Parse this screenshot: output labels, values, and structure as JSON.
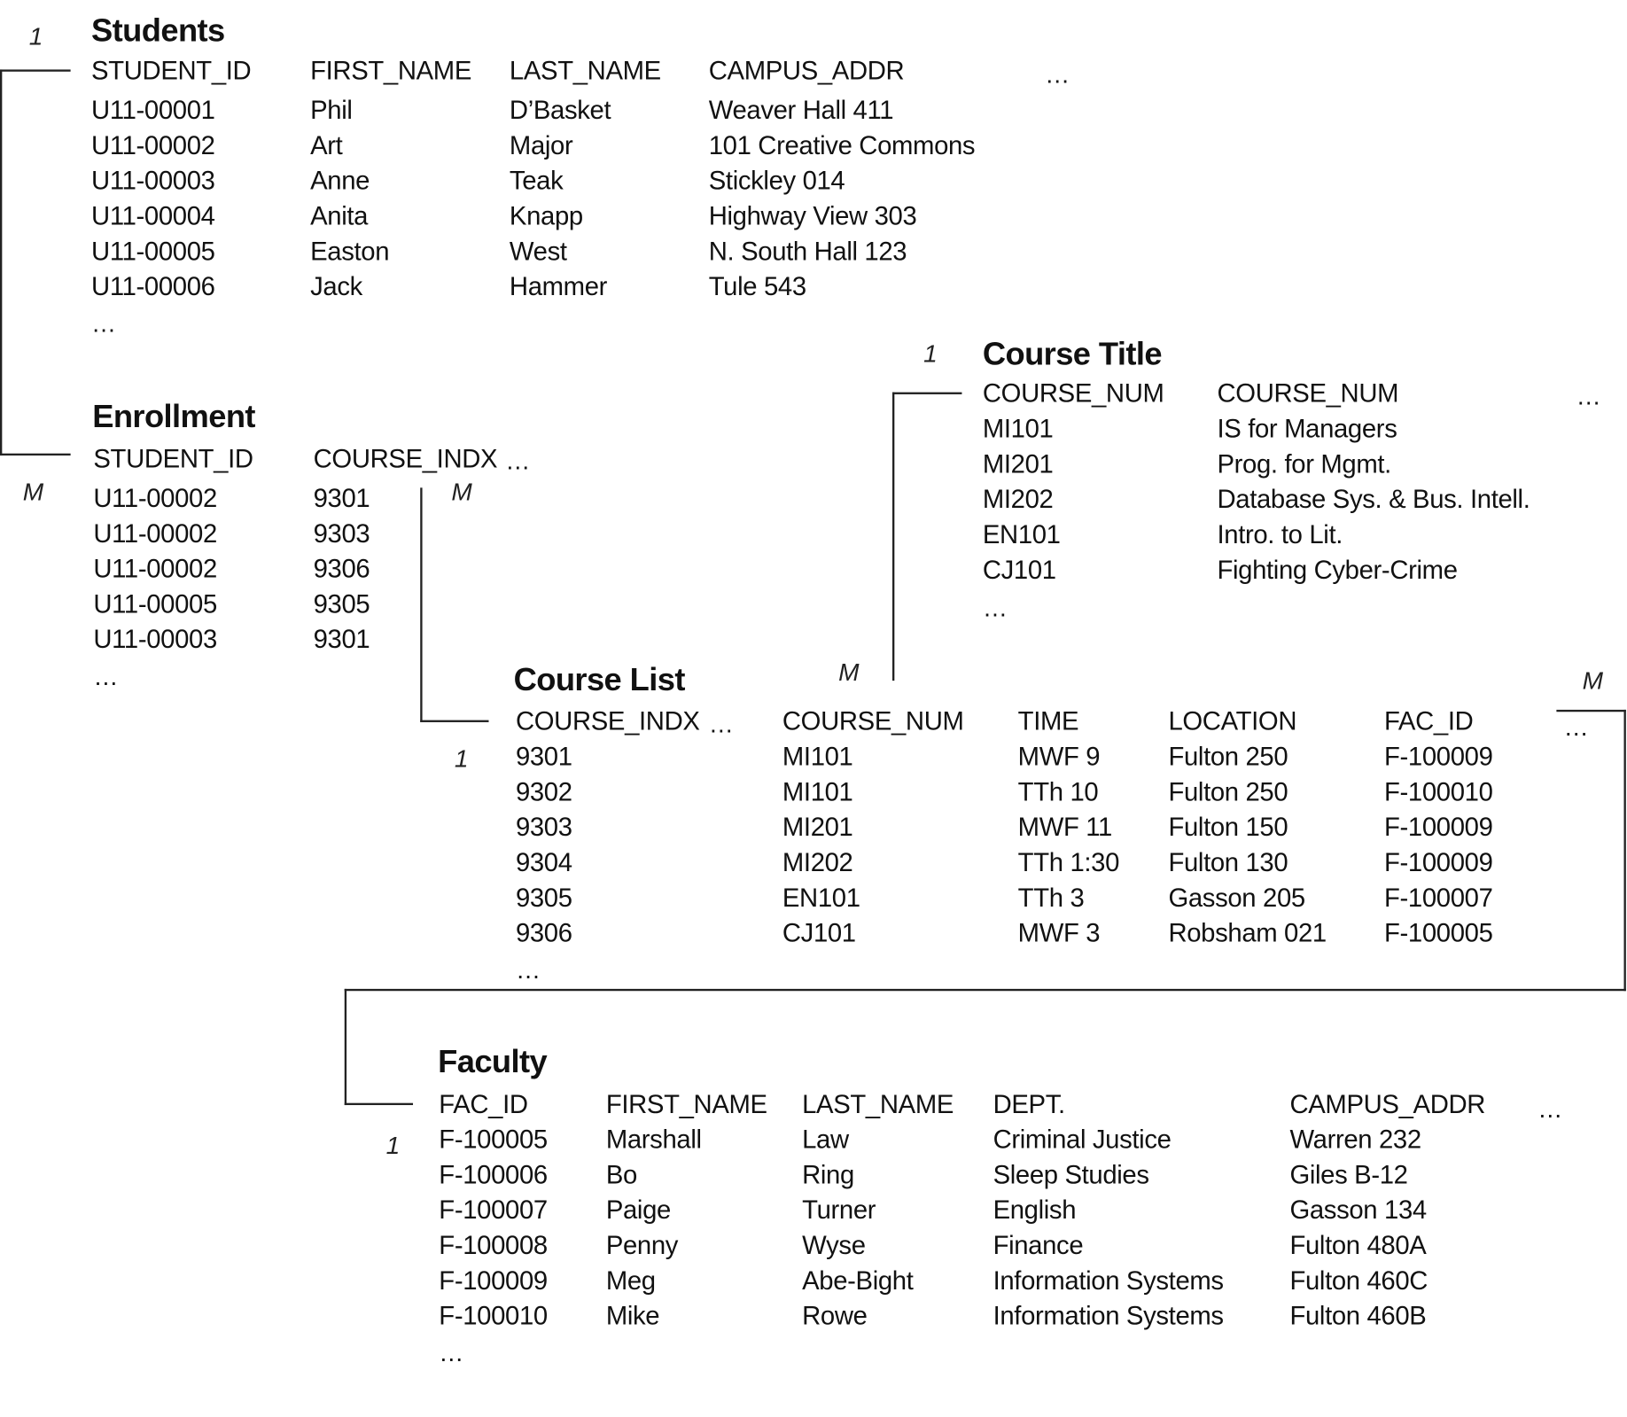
{
  "tables": {
    "students": {
      "title": "Students",
      "columns": [
        "STUDENT_ID",
        "FIRST_NAME",
        "LAST_NAME",
        "CAMPUS_ADDR"
      ],
      "more_columns": "…",
      "rows": [
        [
          "U11-00001",
          "Phil",
          "D’Basket",
          "Weaver Hall 411"
        ],
        [
          "U11-00002",
          "Art",
          "Major",
          "101 Creative Commons"
        ],
        [
          "U11-00003",
          "Anne",
          "Teak",
          "Stickley 014"
        ],
        [
          "U11-00004",
          "Anita",
          "Knapp",
          "Highway View 303"
        ],
        [
          "U11-00005",
          "Easton",
          "West",
          "N. South Hall 123"
        ],
        [
          "U11-00006",
          "Jack",
          "Hammer",
          "Tule 543"
        ]
      ],
      "more_rows": "…"
    },
    "enrollment": {
      "title": "Enrollment",
      "columns": [
        "STUDENT_ID",
        "COURSE_INDX"
      ],
      "more_columns": "…",
      "rows": [
        [
          "U11-00002",
          "9301"
        ],
        [
          "U11-00002",
          "9303"
        ],
        [
          "U11-00002",
          "9306"
        ],
        [
          "U11-00005",
          "9305"
        ],
        [
          "U11-00003",
          "9301"
        ]
      ],
      "more_rows": "…"
    },
    "course_title": {
      "title": "Course Title",
      "columns": [
        "COURSE_NUM",
        "COURSE_NUM"
      ],
      "more_columns": "…",
      "rows": [
        [
          "MI101",
          "IS for Managers"
        ],
        [
          "MI201",
          "Prog. for Mgmt."
        ],
        [
          "MI202",
          "Database Sys. & Bus. Intell."
        ],
        [
          "EN101",
          "Intro. to Lit."
        ],
        [
          "CJ101",
          "Fighting Cyber-Crime"
        ]
      ],
      "more_rows": "…"
    },
    "course_list": {
      "title": "Course List",
      "columns": [
        "COURSE_INDX",
        "COURSE_NUM",
        "TIME",
        "LOCATION",
        "FAC_ID"
      ],
      "inner_more_columns": "…",
      "more_columns": "…",
      "rows": [
        [
          "9301",
          "MI101",
          "MWF 9",
          "Fulton 250",
          "F-100009"
        ],
        [
          "9302",
          "MI101",
          "TTh 10",
          "Fulton 250",
          "F-100010"
        ],
        [
          "9303",
          "MI201",
          "MWF 11",
          "Fulton 150",
          "F-100009"
        ],
        [
          "9304",
          "MI202",
          "TTh 1:30",
          "Fulton 130",
          "F-100009"
        ],
        [
          "9305",
          "EN101",
          "TTh 3",
          "Gasson 205",
          "F-100007"
        ],
        [
          "9306",
          "CJ101",
          "MWF 3",
          "Robsham 021",
          "F-100005"
        ]
      ],
      "more_rows": "…"
    },
    "faculty": {
      "title": "Faculty",
      "columns": [
        "FAC_ID",
        "FIRST_NAME",
        "LAST_NAME",
        "DEPT.",
        "CAMPUS_ADDR"
      ],
      "more_columns": "…",
      "rows": [
        [
          "F-100005",
          "Marshall",
          "Law",
          "Criminal Justice",
          "Warren 232"
        ],
        [
          "F-100006",
          "Bo",
          "Ring",
          "Sleep Studies",
          "Giles B-12"
        ],
        [
          "F-100007",
          "Paige",
          "Turner",
          "English",
          "Gasson 134"
        ],
        [
          "F-100008",
          "Penny",
          "Wyse",
          "Finance",
          "Fulton 480A"
        ],
        [
          "F-100009",
          "Meg",
          "Abe-Bight",
          "Information Systems",
          "Fulton 460C"
        ],
        [
          "F-100010",
          "Mike",
          "Rowe",
          "Information Systems",
          "Fulton 460B"
        ]
      ],
      "more_rows": "…"
    }
  },
  "relationships": [
    {
      "from": "Students.STUDENT_ID",
      "to": "Enrollment.STUDENT_ID",
      "from_cardinality": "1",
      "to_cardinality": "M"
    },
    {
      "from": "Course List.COURSE_INDX",
      "to": "Enrollment.COURSE_INDX",
      "from_cardinality": "1",
      "to_cardinality": "M"
    },
    {
      "from": "Course Title.COURSE_NUM",
      "to": "Course List.COURSE_NUM",
      "from_cardinality": "1",
      "to_cardinality": "M"
    },
    {
      "from": "Faculty.FAC_ID",
      "to": "Course List.FAC_ID",
      "from_cardinality": "1",
      "to_cardinality": "M"
    }
  ]
}
